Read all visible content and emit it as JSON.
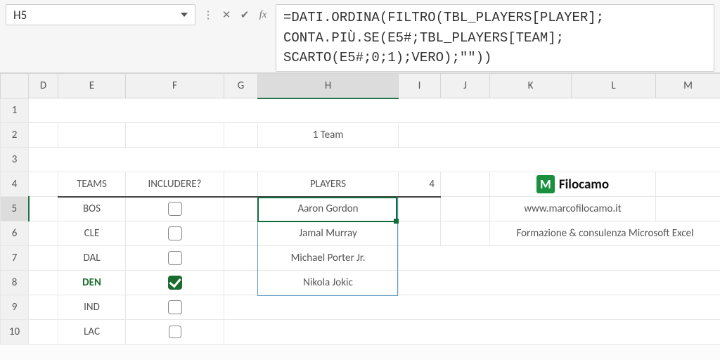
{
  "namebox": "H5",
  "formula": "=DATI.ORDINA(FILTRO(TBL_PLAYERS[PLAYER];\nCONTA.PIÙ.SE(E5#;TBL_PLAYERS[TEAM];\nSCARTO(E5#;0;1);VERO);\"\"))",
  "columns": [
    "D",
    "E",
    "F",
    "G",
    "H",
    "I",
    "J",
    "K",
    "L",
    "M"
  ],
  "row_numbers": [
    "1",
    "2",
    "3",
    "4",
    "5",
    "6",
    "7",
    "8",
    "9",
    "10"
  ],
  "subtitle_count": "1",
  "subtitle_label": "Team",
  "headers": {
    "teams": "TEAMS",
    "include": "INCLUDERE?",
    "players": "PLAYERS",
    "players_count": "4"
  },
  "teams": [
    {
      "name": "BOS",
      "checked": false
    },
    {
      "name": "CLE",
      "checked": false
    },
    {
      "name": "DAL",
      "checked": false
    },
    {
      "name": "DEN",
      "checked": true
    },
    {
      "name": "IND",
      "checked": false
    },
    {
      "name": "LAC",
      "checked": false
    }
  ],
  "players": [
    "Aaron Gordon",
    "Jamal Murray",
    "Michael Porter Jr.",
    "Nikola Jokic"
  ],
  "brand": {
    "logo_letter": "M",
    "name": "Filocamo",
    "url": "www.marcofilocamo.it",
    "tagline": "Formazione & consulenza Microsoft Excel"
  }
}
